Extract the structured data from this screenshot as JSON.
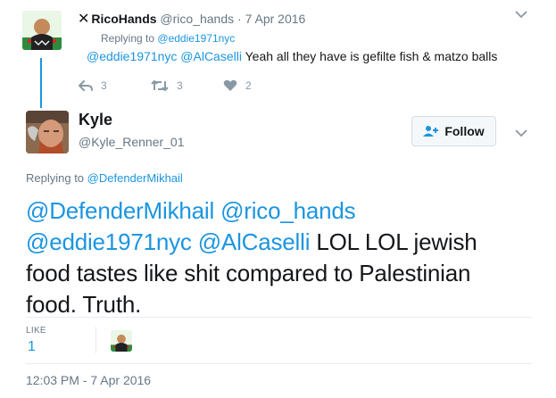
{
  "parent": {
    "prefix": "✕",
    "name": "RicoHands",
    "handle": "@rico_hands",
    "separator": "·",
    "date": "7 Apr 2016",
    "replying_prefix": "Replying to",
    "replying_to": "@eddie1971nyc",
    "mentions": "@eddie1971nyc @AlCaselli",
    "text": "Yeah all they have is gefilte fish & matzo balls",
    "reply_count": "3",
    "retweet_count": "3",
    "like_count": "2"
  },
  "tweet": {
    "name": "Kyle",
    "handle": "@Kyle_Renner_01",
    "follow_label": "Follow",
    "replying_prefix": "Replying to",
    "replying_to": "@DefenderMikhail",
    "mentions_line1": "@DefenderMikhail @rico_hands",
    "mentions_line2": "@eddie1971nyc @AlCaselli",
    "text_line2": "LOL LOL jewish",
    "text_line3": "food tastes like shit compared to Palestinian",
    "text_line4": "food. Truth.",
    "like_label": "LIKE",
    "like_count": "1",
    "timestamp": "12:03 PM - 7 Apr 2016"
  },
  "colors": {
    "link": "#1b95e0",
    "muted": "#657786",
    "thread_line": "#1b95e0"
  }
}
